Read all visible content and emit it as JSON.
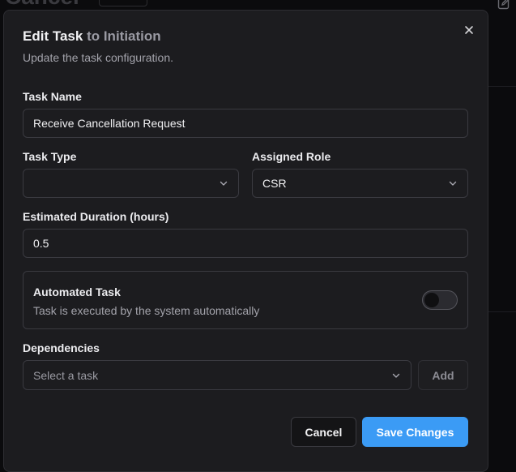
{
  "background": {
    "title": "Cancel"
  },
  "dialog": {
    "title": "Edit Task",
    "title_suffix": "to Initiation",
    "subtitle": "Update the task configuration.",
    "fields": {
      "task_name": {
        "label": "Task Name",
        "value": "Receive Cancellation Request"
      },
      "task_type": {
        "label": "Task Type",
        "value": ""
      },
      "assigned_role": {
        "label": "Assigned Role",
        "value": "CSR"
      },
      "estimated_duration": {
        "label": "Estimated Duration (hours)",
        "value": "0.5"
      }
    },
    "automated": {
      "title": "Automated Task",
      "description": "Task is executed by the system automatically",
      "enabled": false
    },
    "dependencies": {
      "label": "Dependencies",
      "placeholder": "Select a task",
      "add_label": "Add"
    },
    "actions": {
      "cancel_label": "Cancel",
      "save_label": "Save Changes"
    }
  },
  "icons": {
    "close": "close-icon",
    "chevron": "chevron-down-icon",
    "edit": "edit-icon"
  },
  "colors": {
    "accent": "#3b9bf5",
    "dialog_bg": "#1c1c1f",
    "border": "#3a3a40"
  }
}
